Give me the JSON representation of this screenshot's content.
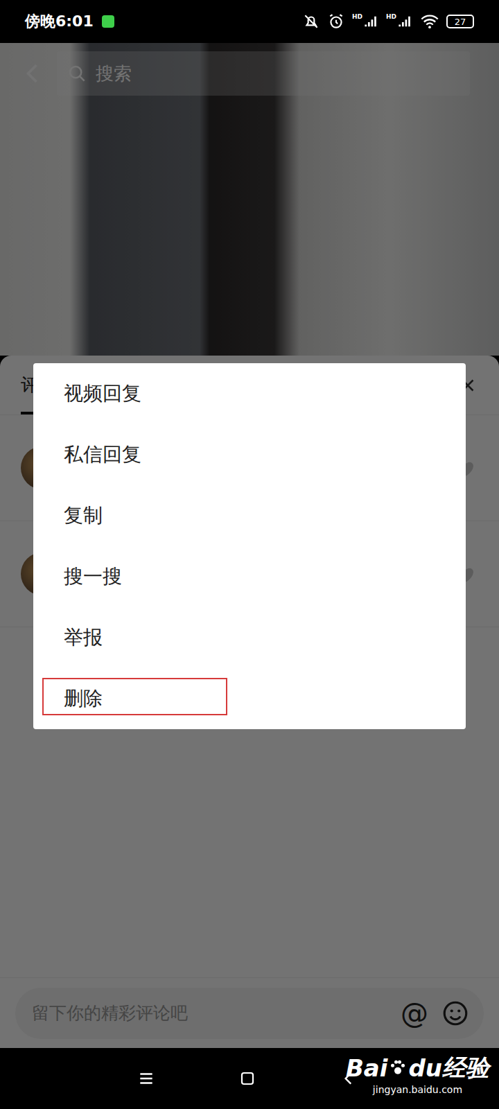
{
  "status_bar": {
    "time": "傍晚6:01",
    "network": [
      "HD",
      "HD"
    ],
    "battery": "27"
  },
  "search": {
    "placeholder": "搜索"
  },
  "comments_panel": {
    "tabs": [
      {
        "label": "评",
        "selected": true
      }
    ],
    "comments": [
      {
        "liked": false
      },
      {
        "liked": false
      }
    ]
  },
  "menu": {
    "items": [
      {
        "label": "视频回复",
        "highlighted": false
      },
      {
        "label": "私信回复",
        "highlighted": false
      },
      {
        "label": "复制",
        "highlighted": false
      },
      {
        "label": "搜一搜",
        "highlighted": false
      },
      {
        "label": "举报",
        "highlighted": false
      },
      {
        "label": "删除",
        "highlighted": true
      }
    ]
  },
  "comment_input": {
    "placeholder": "留下你的精彩评论吧",
    "at": "@"
  },
  "watermark": {
    "brand": "Bai",
    "brand2": "du",
    "product": "经验",
    "url": "jingyan.baidu.com"
  }
}
